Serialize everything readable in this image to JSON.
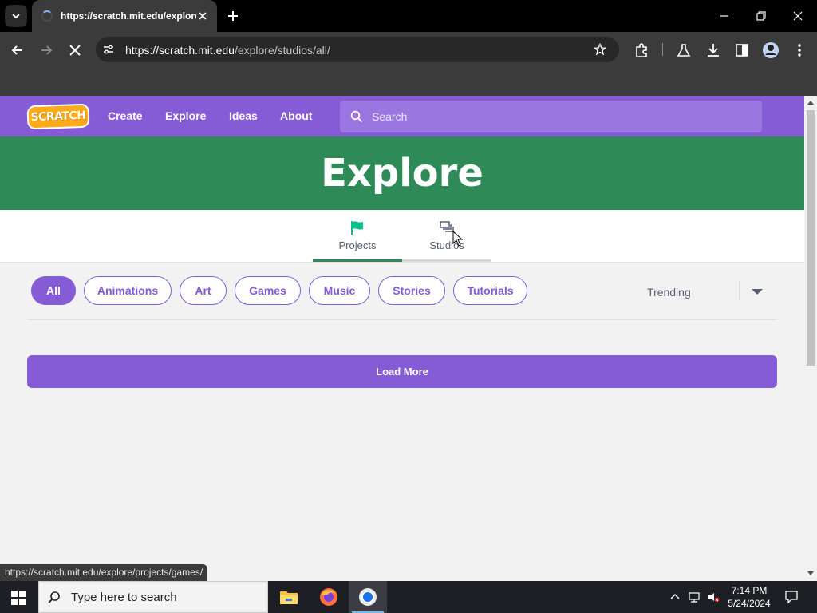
{
  "browser": {
    "tab_title": "https://scratch.mit.edu/explore",
    "url_host": "https://scratch.mit.edu",
    "url_path": "/explore/studios/all/",
    "status_url": "https://scratch.mit.edu/explore/projects/games/"
  },
  "scratch_nav": {
    "logo_text": "SCRATCH",
    "links": [
      "Create",
      "Explore",
      "Ideas",
      "About"
    ],
    "search_placeholder": "Search"
  },
  "banner": {
    "title": "Explore"
  },
  "sub_tabs": [
    {
      "label": "Projects",
      "icon": "flag-icon",
      "selected": true
    },
    {
      "label": "Studios",
      "icon": "studios-icon",
      "selected": false
    }
  ],
  "categories": [
    {
      "label": "All",
      "active": true
    },
    {
      "label": "Animations",
      "active": false
    },
    {
      "label": "Art",
      "active": false
    },
    {
      "label": "Games",
      "active": false
    },
    {
      "label": "Music",
      "active": false
    },
    {
      "label": "Stories",
      "active": false
    },
    {
      "label": "Tutorials",
      "active": false
    }
  ],
  "sort": {
    "selected": "Trending"
  },
  "load_more_label": "Load More",
  "taskbar": {
    "search_text": "Type here to search",
    "time": "7:14 PM",
    "date": "5/24/2024"
  },
  "colors": {
    "scratch_purple": "#855cd6",
    "banner_green": "#2e8b57",
    "projects_teal": "#0fbd8c",
    "logo_orange": "#ffab19"
  }
}
